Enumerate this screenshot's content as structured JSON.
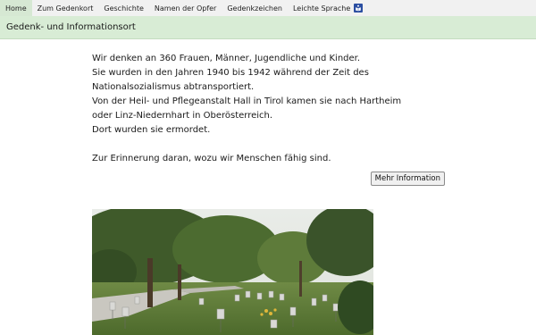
{
  "nav": {
    "items": [
      {
        "label": "Home",
        "active": true
      },
      {
        "label": "Zum Gedenkort",
        "active": false
      },
      {
        "label": "Geschichte",
        "active": false
      },
      {
        "label": "Namen der Opfer",
        "active": false
      },
      {
        "label": "Gedenkzeichen",
        "active": false
      },
      {
        "label": "Leichte Sprache",
        "active": false,
        "icon": "easy-language-icon"
      }
    ]
  },
  "subheader": {
    "title": "Gedenk- und Informationsort"
  },
  "main": {
    "lines": [
      "Wir denken an 360 Frauen, Männer, Jugendliche und Kinder.",
      "Sie wurden in den Jahren 1940 bis 1942 während der Zeit des",
      "Nationalsozialismus abtransportiert.",
      "Von der Heil- und Pflegeanstalt Hall in Tirol kamen sie nach Hartheim",
      "oder Linz-Niedernhart in Oberösterreich.",
      "Dort wurden sie ermordet."
    ],
    "closing": "Zur Erinnerung daran, wozu wir Menschen fähig sind.",
    "more_button": "Mehr Information"
  },
  "colors": {
    "nav_bg": "#f1f1f1",
    "nav_active": "#d6e8d3",
    "subbar_bg": "#d8ecd5",
    "easy_language_icon": "#2b4ea1"
  }
}
